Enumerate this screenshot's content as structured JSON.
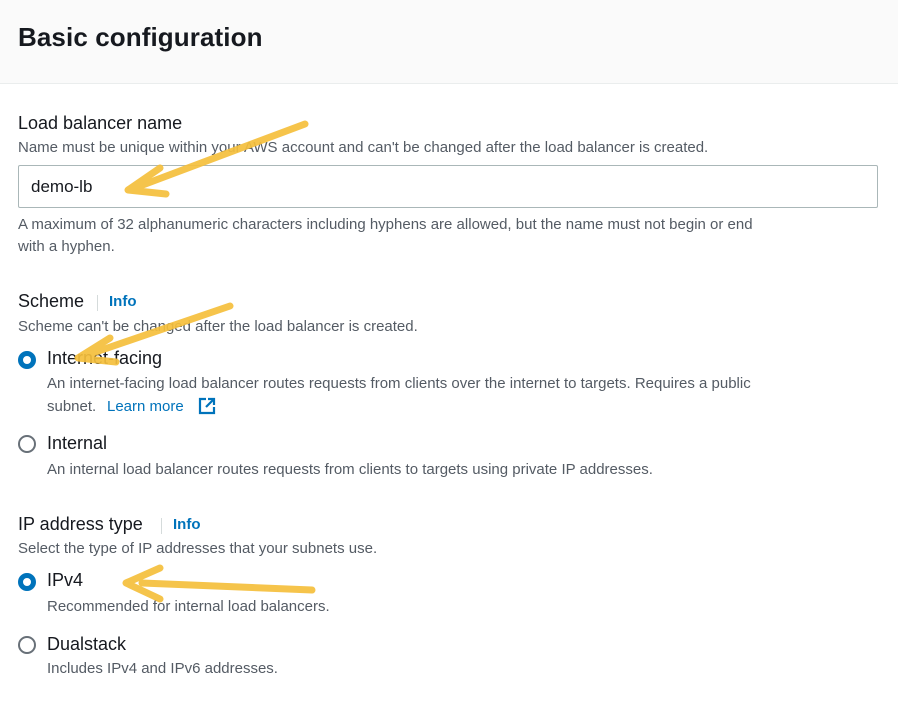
{
  "header": {
    "title": "Basic configuration"
  },
  "lb_name": {
    "label": "Load balancer name",
    "description": "Name must be unique within your AWS account and can't be changed after the load balancer is created.",
    "value": "demo-lb",
    "constraint_line1": "A maximum of 32 alphanumeric characters including hyphens are allowed, but the name must not begin or end",
    "constraint_line2": "with a hyphen."
  },
  "scheme": {
    "label": "Scheme",
    "info": "Info",
    "description": "Scheme can't be changed after the load balancer is created.",
    "options": [
      {
        "label": "Internet-facing",
        "desc_line1": "An internet-facing load balancer routes requests from clients over the internet to targets. Requires a public",
        "desc_line2": "subnet.",
        "link": "Learn more",
        "selected": true
      },
      {
        "label": "Internal",
        "desc_line1": "An internal load balancer routes requests from clients to targets using private IP addresses.",
        "selected": false
      }
    ]
  },
  "ip_type": {
    "label": "IP address type",
    "info": "Info",
    "description": "Select the type of IP addresses that your subnets use.",
    "options": [
      {
        "label": "IPv4",
        "desc_line1": "Recommended for internal load balancers.",
        "selected": true
      },
      {
        "label": "Dualstack",
        "desc_line1": "Includes IPv4 and IPv6 addresses.",
        "selected": false
      }
    ]
  },
  "colors": {
    "accent": "#0073bb",
    "annotation_arrow": "#f5bf3c"
  },
  "icons": [
    "external-link-icon",
    "annotation-arrow"
  ]
}
